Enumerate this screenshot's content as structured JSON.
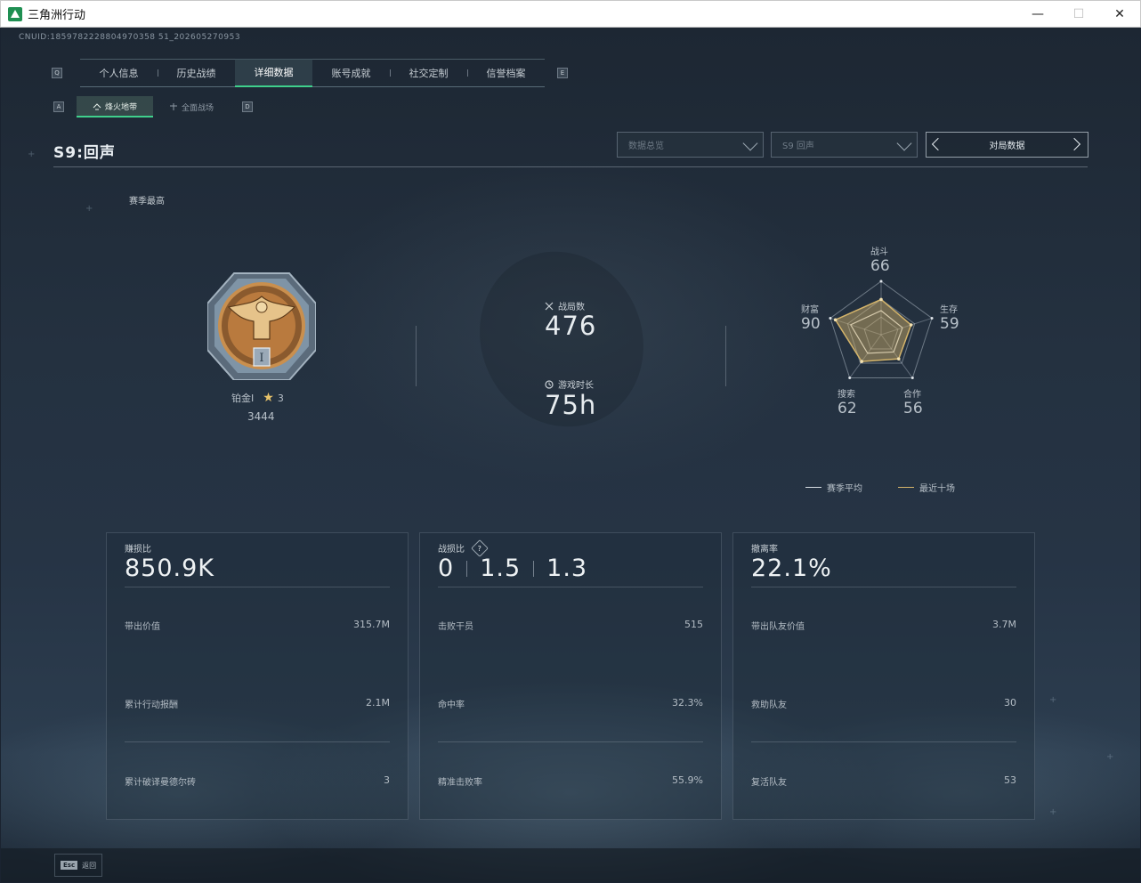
{
  "window": {
    "title": "三角洲行动",
    "minimize": "—",
    "maximize": "☐",
    "close": "✕"
  },
  "uid": "CNUID:1859782228804970358 51_202605270953",
  "main_tabs": {
    "left_key": "Q",
    "right_key": "E",
    "items": [
      {
        "label": "个人信息"
      },
      {
        "label": "历史战绩"
      },
      {
        "label": "详细数据"
      },
      {
        "label": "账号成就"
      },
      {
        "label": "社交定制"
      },
      {
        "label": "信誉档案"
      }
    ],
    "active_index": 2
  },
  "sub_tabs": {
    "left_key": "A",
    "right_key": "D",
    "items": [
      {
        "label": "烽火地带"
      },
      {
        "label": "全面战场"
      }
    ],
    "active_index": 0
  },
  "season": {
    "title": "S9:回声"
  },
  "filters": {
    "overview": {
      "value": "数据总览"
    },
    "season_select": {
      "value": "S9 回声"
    },
    "match_data": {
      "label": "对局数据"
    }
  },
  "season_high_label": "赛季最高",
  "rank": {
    "name": "铂金I",
    "stars": "3",
    "score": "3444",
    "numeral": "I"
  },
  "stats": {
    "matches_label": "战局数",
    "matches_value": "476",
    "playtime_label": "游戏时长",
    "playtime_value": "75h"
  },
  "radar": {
    "axes": [
      {
        "label": "战斗",
        "value": "66"
      },
      {
        "label": "生存",
        "value": "59"
      },
      {
        "label": "合作",
        "value": "56"
      },
      {
        "label": "搜索",
        "value": "62"
      },
      {
        "label": "财富",
        "value": "90"
      }
    ],
    "series_values": {
      "season_avg": [
        45,
        42,
        40,
        43,
        60
      ],
      "recent_ten": [
        66,
        59,
        56,
        62,
        90
      ]
    },
    "legend": [
      {
        "label": "赛季平均",
        "color": "#d7dde2"
      },
      {
        "label": "最近十场",
        "color": "#d4b46a"
      }
    ]
  },
  "panels": [
    {
      "title": "赚损比",
      "big_value": "850.9K",
      "rows": [
        {
          "label": "带出价值",
          "value": "315.7M"
        },
        {
          "label": "累计行动报酬",
          "value": "2.1M"
        },
        {
          "label": "累计破译曼德尔砖",
          "value": "3"
        }
      ]
    },
    {
      "title": "战损比",
      "help": "?",
      "ratios": [
        "0",
        "1.5",
        "1.3"
      ],
      "rows": [
        {
          "label": "击败干员",
          "value": "515"
        },
        {
          "label": "命中率",
          "value": "32.3%"
        },
        {
          "label": "精准击败率",
          "value": "55.9%"
        }
      ]
    },
    {
      "title": "撤离率",
      "big_value": "22.1%",
      "rows": [
        {
          "label": "带出队友价值",
          "value": "3.7M"
        },
        {
          "label": "救助队友",
          "value": "30"
        },
        {
          "label": "复活队友",
          "value": "53"
        }
      ]
    }
  ],
  "footer": {
    "esc_key": "Esc",
    "esc_label": "返回"
  },
  "colors": {
    "accent": "#3fd08c",
    "gold": "#d4b46a"
  }
}
